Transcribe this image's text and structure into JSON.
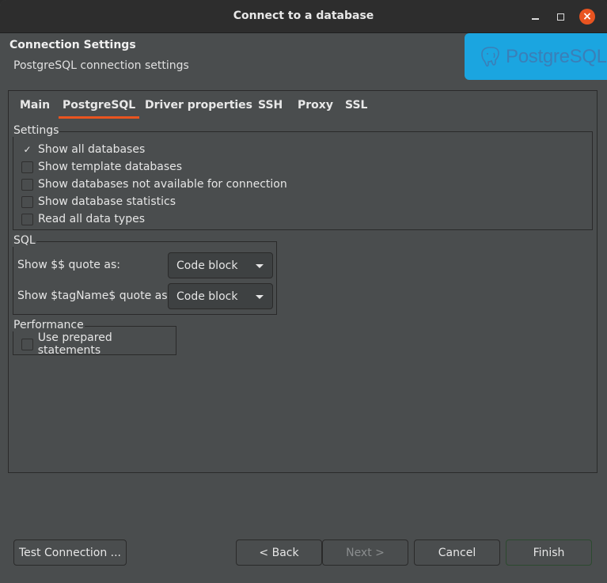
{
  "window": {
    "title": "Connect to a database"
  },
  "header": {
    "title": "Connection Settings",
    "subtitle": "PostgreSQL connection settings",
    "logo_text": "PostgreSQL"
  },
  "tabs": [
    {
      "label": "Main"
    },
    {
      "label": "PostgreSQL"
    },
    {
      "label": "Driver properties"
    },
    {
      "label": "SSH"
    },
    {
      "label": "Proxy"
    },
    {
      "label": "SSL"
    }
  ],
  "settings": {
    "label": "Settings",
    "items": [
      {
        "label": "Show all databases",
        "checked": true
      },
      {
        "label": "Show template databases",
        "checked": false
      },
      {
        "label": "Show databases not available for connection",
        "checked": false
      },
      {
        "label": "Show database statistics",
        "checked": false
      },
      {
        "label": "Read all data types",
        "checked": false
      }
    ]
  },
  "sql": {
    "label": "SQL",
    "quote_label": "Show $$ quote as:",
    "quote_value": "Code block",
    "tag_label": "Show $tagName$ quote as:",
    "tag_value": "Code block"
  },
  "performance": {
    "label": "Performance",
    "prepared_label": "Use prepared statements",
    "prepared_checked": false
  },
  "buttons": {
    "test": "Test Connection ...",
    "back": "< Back",
    "next": "Next >",
    "cancel": "Cancel",
    "finish": "Finish"
  },
  "colors": {
    "accent": "#e95420",
    "logo_bg": "#1ba5e0"
  }
}
